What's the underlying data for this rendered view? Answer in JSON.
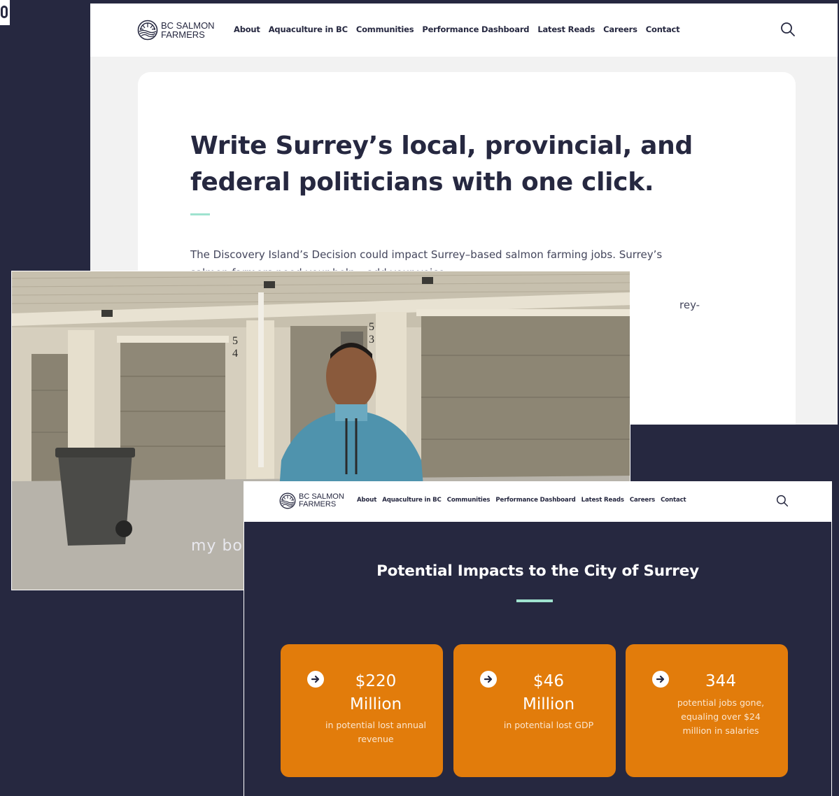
{
  "brand": {
    "line1": "BC SALMON",
    "line2": "FARMERS"
  },
  "nav": {
    "items": [
      "About",
      "Aquaculture in BC",
      "Communities",
      "Performance Dashboard",
      "Latest Reads",
      "Careers",
      "Contact"
    ]
  },
  "icons": {
    "logo": "salmon-sunrise-logo-icon",
    "search": "search-icon",
    "arrow": "arrow-right-circle-icon"
  },
  "colors": {
    "navy": "#262840",
    "orange": "#e27c0b",
    "mint": "#9fe3cf"
  },
  "hero": {
    "headline": "Write Surrey’s local, provincial, and federal politicians with one click.",
    "intro": "The Discovery Island’s Decision could impact Surrey–based salmon farming jobs. Surrey’s salmon farmers need your help – add your voice.",
    "partial_text": "rey-"
  },
  "video": {
    "caption_fragment": "my bo"
  },
  "impacts": {
    "title": "Potential Impacts to the City of Surrey",
    "stats": [
      {
        "value_line1": "$220",
        "value_line2": "Million",
        "description": "in potential lost annual revenue"
      },
      {
        "value_line1": "$46",
        "value_line2": "Million",
        "description": "in potential lost GDP"
      },
      {
        "value_line1": "344",
        "value_line2": "",
        "description": "potential jobs gone, equaling over $24 million in salaries"
      }
    ]
  }
}
